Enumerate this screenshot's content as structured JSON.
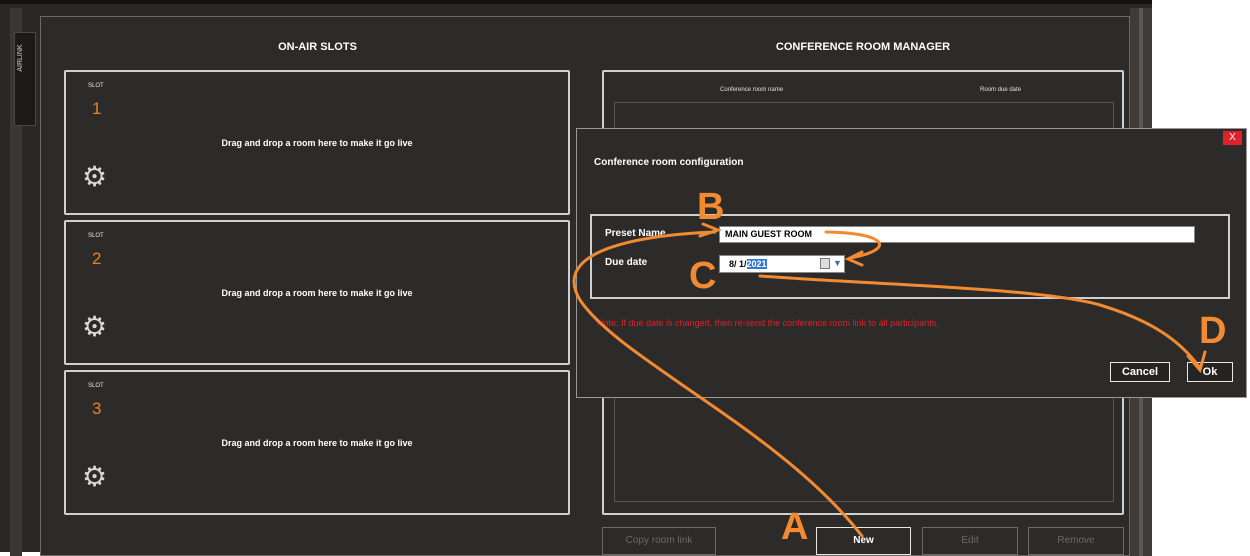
{
  "side_tab": {
    "label": "AIRLINK"
  },
  "slots_panel": {
    "title": "ON-AIR SLOTS",
    "slots": [
      {
        "label": "SLOT",
        "number": "1",
        "message": "Drag and drop a room here to make it go live"
      },
      {
        "label": "SLOT",
        "number": "2",
        "message": "Drag and drop a room here to make it go live"
      },
      {
        "label": "SLOT",
        "number": "3",
        "message": "Drag and drop a room here to make it go live"
      }
    ]
  },
  "room_manager": {
    "title": "CONFERENCE ROOM MANAGER",
    "columns": [
      "Conference room name",
      "Room due date"
    ],
    "buttons": {
      "copy_link": "Copy room link",
      "new": "New",
      "edit": "Edit",
      "remove": "Remove"
    }
  },
  "dialog": {
    "close_label": "X",
    "title": "Conference room configuration",
    "preset_name_label": "Preset Name",
    "preset_name_value": "MAIN GUEST ROOM",
    "due_date_label": "Due date",
    "due_date_prefix": "8/ 1/",
    "due_date_year": "2021",
    "note": "Note: If due date is changed, then re-send the conference room link to all participants.",
    "cancel_label": "Cancel",
    "ok_label": "Ok"
  },
  "annotations": {
    "a": "A",
    "b": "B",
    "c": "C",
    "d": "D"
  },
  "colors": {
    "accent": "#f07f1a",
    "annotation": "#f28a32",
    "note": "#e0212b",
    "selection": "#3478d6"
  }
}
